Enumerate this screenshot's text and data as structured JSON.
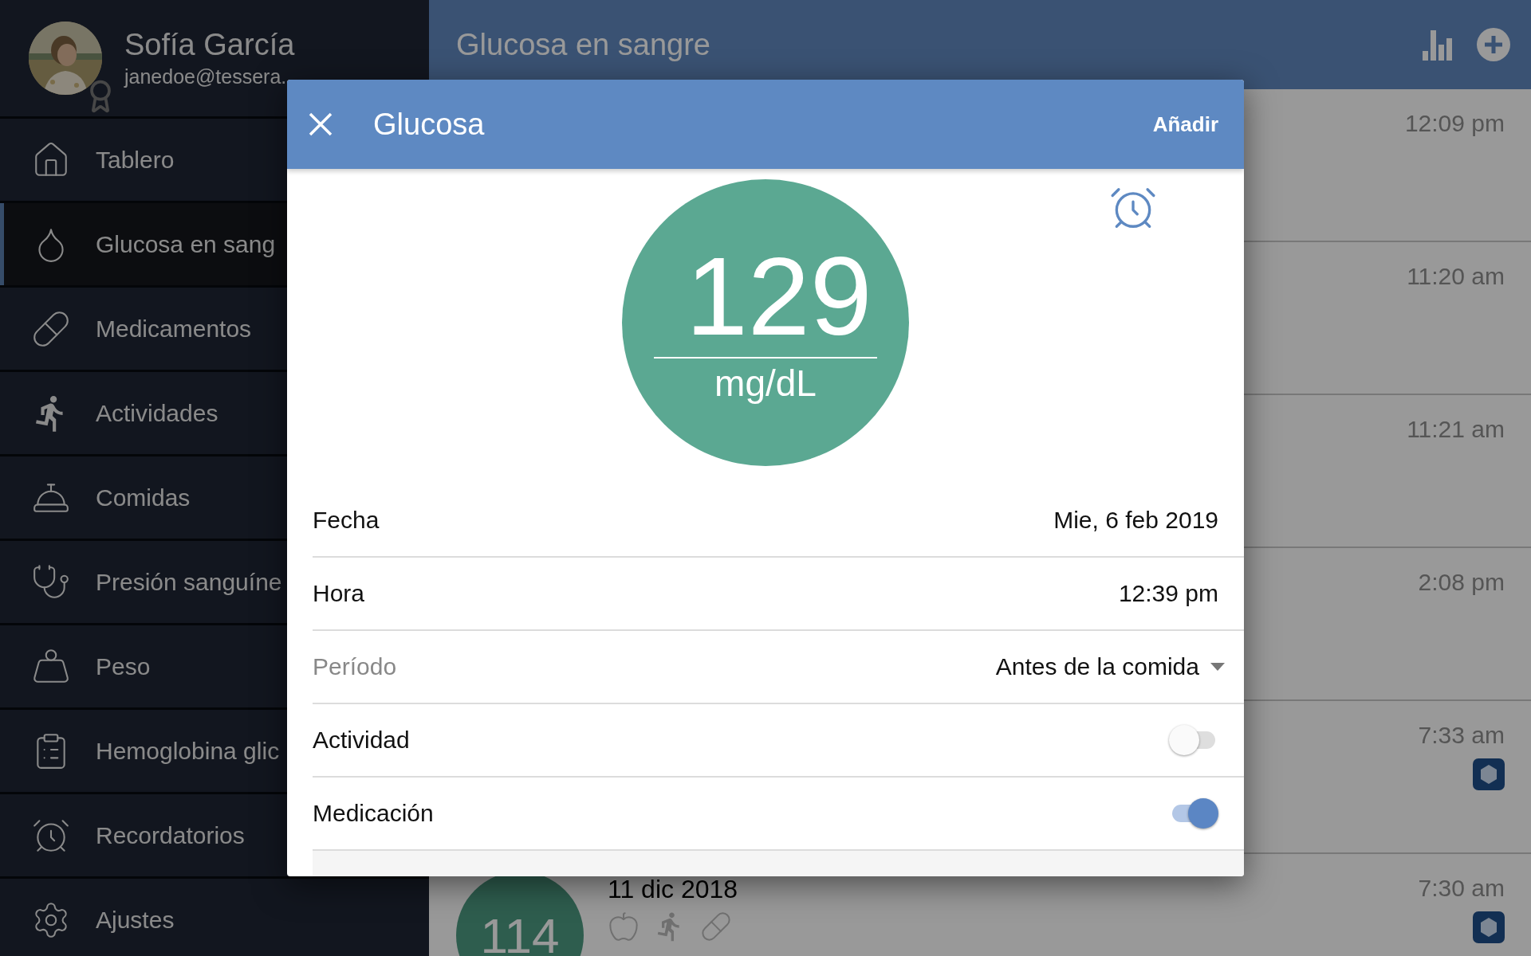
{
  "sidebar": {
    "profile": {
      "name": "Sofía García",
      "email": "janedoe@tessera."
    },
    "items": [
      {
        "kind": "home",
        "label": "Tablero",
        "selected": false
      },
      {
        "kind": "drop",
        "label": "Glucosa en sang",
        "selected": true
      },
      {
        "kind": "medication",
        "label": "Medicamentos",
        "selected": false
      },
      {
        "kind": "activity",
        "label": "Actividades",
        "selected": false
      },
      {
        "kind": "meal",
        "label": "Comidas",
        "selected": false
      },
      {
        "kind": "pressure",
        "label": "Presión sanguíne",
        "selected": false
      },
      {
        "kind": "weight",
        "label": "Peso",
        "selected": false
      },
      {
        "kind": "clipboard",
        "label": "Hemoglobina glic",
        "selected": false
      },
      {
        "kind": "alarm",
        "label": "Recordatorios",
        "selected": false
      },
      {
        "kind": "settings",
        "label": "Ajustes",
        "selected": false
      }
    ]
  },
  "header": {
    "title": "Glucosa en sangre"
  },
  "entries": [
    {
      "time": "12:09 pm",
      "badge": false
    },
    {
      "time": "11:20 am",
      "badge": false
    },
    {
      "time": "11:21 am",
      "badge": false
    },
    {
      "time": "2:08 pm",
      "badge": false
    },
    {
      "time": "7:33 am",
      "badge": true
    },
    {
      "time": "7:30 am",
      "badge": true,
      "value": "114",
      "date": "11 dic 2018",
      "tags": [
        {
          "kind": "meal"
        },
        {
          "kind": "activity"
        },
        {
          "kind": "medication"
        }
      ]
    }
  ],
  "dialog": {
    "title": "Glucosa",
    "action": "Añadir",
    "reading": {
      "value": "129",
      "unit": "mg/dL"
    },
    "fields": [
      {
        "kind": "value",
        "label": "Fecha",
        "value": "Mie, 6 feb 2019"
      },
      {
        "kind": "value",
        "label": "Hora",
        "value": "12:39 pm"
      },
      {
        "kind": "select",
        "label": "Período",
        "value": "Antes de la comida"
      },
      {
        "kind": "toggle",
        "label": "Actividad",
        "on": false
      },
      {
        "kind": "toggle",
        "label": "Medicación",
        "on": true
      }
    ]
  }
}
